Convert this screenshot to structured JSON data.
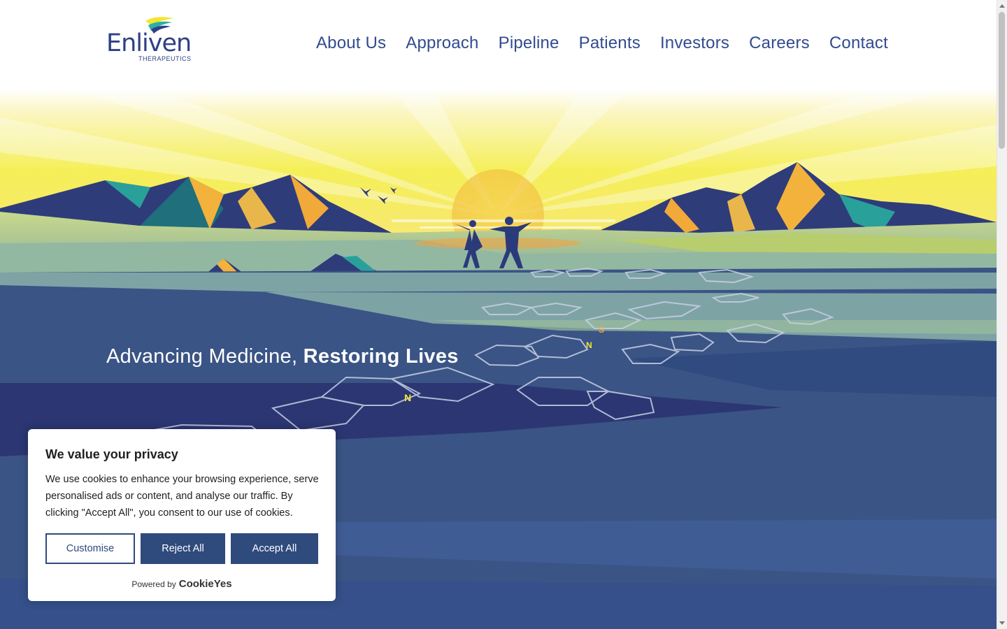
{
  "brand": {
    "name": "Enliven",
    "subtitle": "THERAPEUTICS"
  },
  "nav": {
    "items": [
      "About Us",
      "Approach",
      "Pipeline",
      "Patients",
      "Investors",
      "Careers",
      "Contact"
    ]
  },
  "hero": {
    "tagline_regular": "Advancing Medicine, ",
    "tagline_bold": "Restoring Lives",
    "molecule_letters": [
      "S",
      "N",
      "N"
    ]
  },
  "cookie": {
    "title": "We value your privacy",
    "text": "We use cookies to enhance your browsing experience, serve personalised ads or content, and analyse our traffic. By clicking \"Accept All\", you consent to our use of cookies.",
    "customise_label": "Customise",
    "reject_label": "Reject All",
    "accept_label": "Accept All",
    "powered_by": "Powered by",
    "powered_brand": "CookieYes"
  },
  "colors": {
    "brand_navy": "#2e3f86",
    "button_blue": "#2f4a7c",
    "ground_blue": "#3a5485",
    "sky_yellow": "#f3ee4a"
  }
}
